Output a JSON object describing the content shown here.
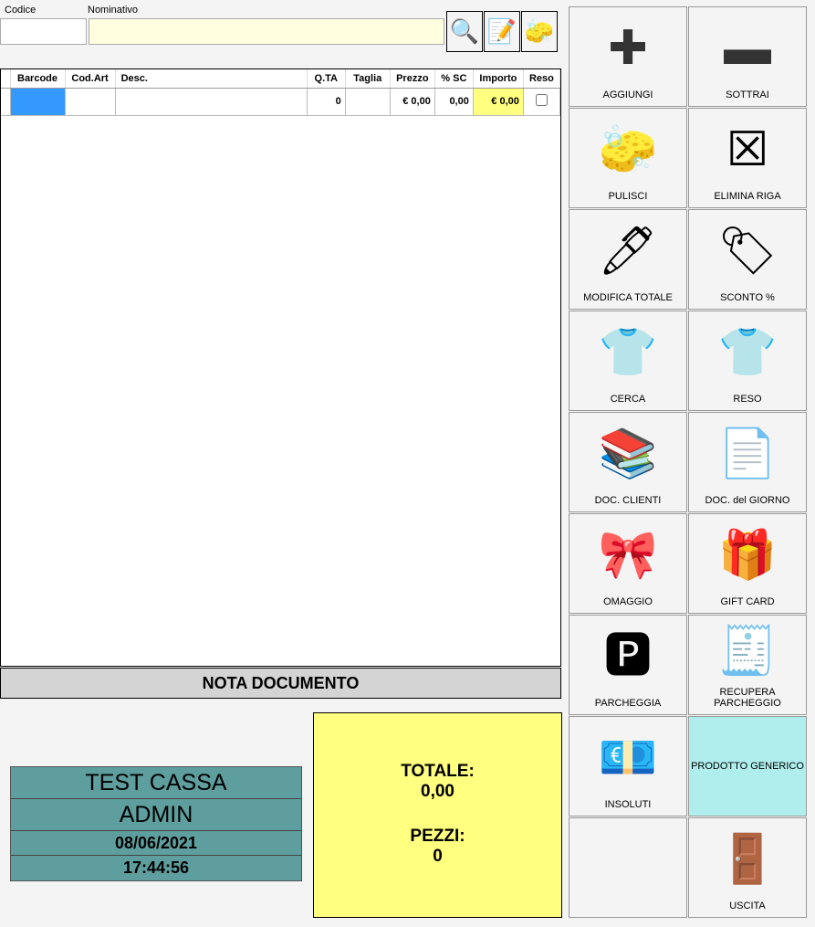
{
  "header": {
    "codice_label": "Codice",
    "nominativo_label": "Nominativo",
    "codice_value": "",
    "nominativo_value": ""
  },
  "toolbar": [
    {
      "icon": "search-icon",
      "glyph": "🔍"
    },
    {
      "icon": "edit-document-icon",
      "glyph": "📝"
    },
    {
      "icon": "eraser-icon",
      "glyph": "🧽"
    }
  ],
  "table": {
    "columns": [
      "Barcode",
      "Cod.Art",
      "Desc.",
      "Q.TA",
      "Taglia",
      "Prezzo",
      "% SC",
      "Importo",
      "Reso"
    ],
    "rows": [
      {
        "barcode": "",
        "cod_art": "",
        "desc": "",
        "qta": "0",
        "taglia": "",
        "prezzo": "€ 0,00",
        "sc": "0,00",
        "importo": "€ 0,00",
        "reso": false
      }
    ]
  },
  "nota_label": "NOTA DOCUMENTO",
  "info": {
    "cassa": "TEST CASSA",
    "user": "ADMIN",
    "date": "08/06/2021",
    "time": "17:44:56"
  },
  "totals": {
    "totale_label": "TOTALE:",
    "totale": "0,00",
    "pezzi_label": "PEZZI:",
    "pezzi": "0"
  },
  "colors": {
    "info_bg": "#5f9e9e",
    "totals_bg": "#ffff80",
    "selected_cell": "#3399ff",
    "prodotto_bg": "#b0eeee"
  },
  "buttons": [
    {
      "label": "AGGIUNGI",
      "icon": "plus-icon",
      "glyph": "✚"
    },
    {
      "label": "SOTTRAI",
      "icon": "minus-icon",
      "glyph": "▬"
    },
    {
      "label": "PULISCI",
      "icon": "eraser-icon",
      "glyph": "🧽"
    },
    {
      "label": "ELIMINA RIGA",
      "icon": "delete-row-icon",
      "glyph": "☒"
    },
    {
      "label": "MODIFICA TOTALE",
      "icon": "pen-icon",
      "glyph": "🖊"
    },
    {
      "label": "SCONTO %",
      "icon": "discount-tag-icon",
      "glyph": "🏷"
    },
    {
      "label": "CERCA",
      "icon": "search-clothes-icon",
      "glyph": "👕"
    },
    {
      "label": "RESO",
      "icon": "return-shirt-icon",
      "glyph": "👕"
    },
    {
      "label": "DOC. CLIENTI",
      "icon": "binders-icon",
      "glyph": "📚"
    },
    {
      "label": "DOC. del GIORNO",
      "icon": "document-search-icon",
      "glyph": "📄"
    },
    {
      "label": "OMAGGIO",
      "icon": "gift-bow-icon",
      "glyph": "🎀"
    },
    {
      "label": "GIFT CARD",
      "icon": "gift-card-icon",
      "glyph": "🎁"
    },
    {
      "label": "PARCHEGGIA",
      "icon": "parking-icon",
      "glyph": "🅿"
    },
    {
      "label": "RECUPERA PARCHEGGIO",
      "icon": "cash-register-parking-icon",
      "glyph": "🧾"
    },
    {
      "label": "INSOLUTI",
      "icon": "unpaid-icon",
      "glyph": "💶"
    },
    {
      "label": "PRODOTTO GENERICO",
      "icon": "",
      "glyph": ""
    },
    {
      "label": "",
      "icon": "",
      "glyph": ""
    },
    {
      "label": "USCITA",
      "icon": "exit-door-icon",
      "glyph": "🚪"
    }
  ]
}
